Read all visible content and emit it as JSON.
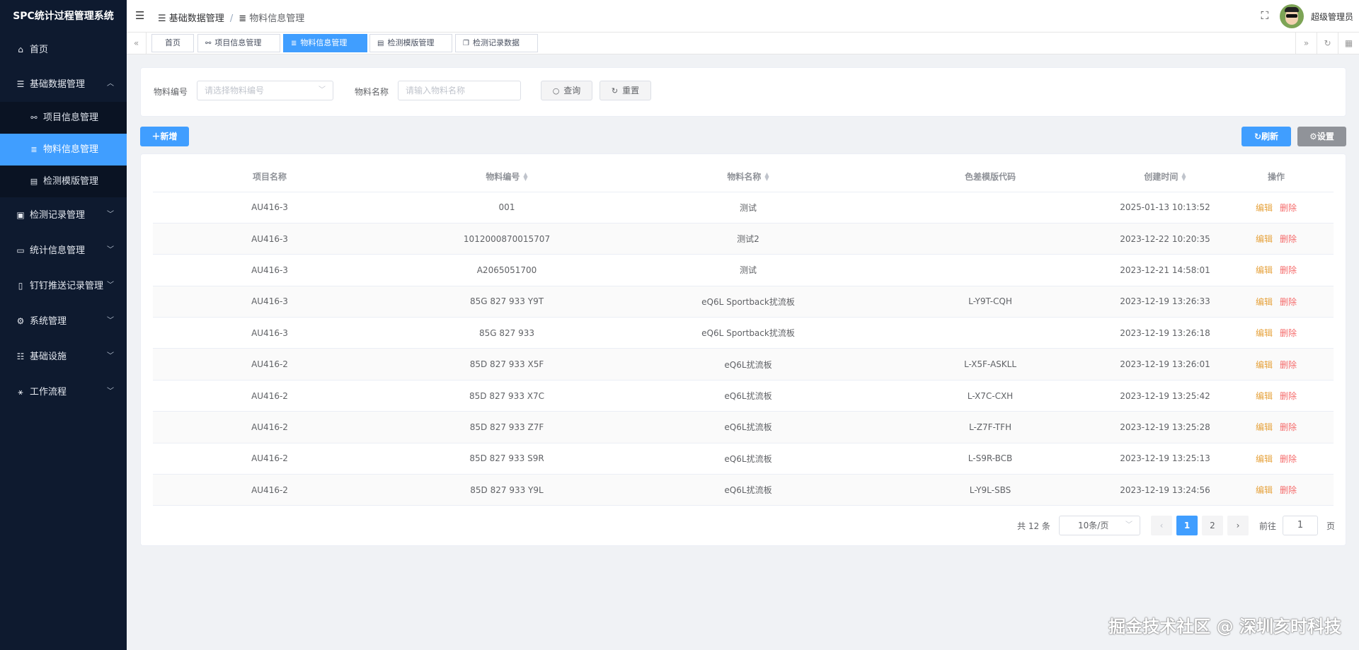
{
  "app": {
    "title": "SPC统计过程管理系统"
  },
  "sidebar": {
    "home": "首页",
    "basic_data": "基础数据管理",
    "sub": [
      "项目信息管理",
      "物料信息管理",
      "检测模版管理"
    ],
    "others": [
      "检测记录管理",
      "统计信息管理",
      "钉钉推送记录管理",
      "系统管理",
      "基础设施",
      "工作流程"
    ]
  },
  "header": {
    "breadcrumb": [
      "基础数据管理",
      "物料信息管理"
    ],
    "username": "超级管理员"
  },
  "tags": [
    "首页",
    "项目信息管理",
    "物料信息管理",
    "检测模版管理",
    "检测记录数据"
  ],
  "search": {
    "code_label": "物料编号",
    "code_placeholder": "请选择物料编号",
    "name_label": "物料名称",
    "name_placeholder": "请输入物料名称",
    "query_label": "查询",
    "reset_label": "重置"
  },
  "toolbar": {
    "add_label": "新增",
    "refresh_label": "刷新",
    "settings_label": "设置"
  },
  "table": {
    "headers": [
      "项目名称",
      "物料编号",
      "物料名称",
      "色差模版代码",
      "创建时间",
      "操作"
    ],
    "edit_label": "编辑",
    "delete_label": "删除",
    "rows": [
      [
        "AU416-3",
        "001",
        "测试",
        "",
        "2025-01-13 10:13:52"
      ],
      [
        "AU416-3",
        "1012000870015707",
        "测试2",
        "",
        "2023-12-22 10:20:35"
      ],
      [
        "AU416-3",
        "A2065051700",
        "测试",
        "",
        "2023-12-21 14:58:01"
      ],
      [
        "AU416-3",
        "85G 827 933 Y9T",
        "eQ6L Sportback扰流板",
        "L-Y9T-CQH",
        "2023-12-19 13:26:33"
      ],
      [
        "AU416-3",
        "85G 827 933",
        "eQ6L Sportback扰流板",
        "",
        "2023-12-19 13:26:18"
      ],
      [
        "AU416-2",
        "85D 827 933 X5F",
        "eQ6L扰流板",
        "L-X5F-ASKLL",
        "2023-12-19 13:26:01"
      ],
      [
        "AU416-2",
        "85D 827 933 X7C",
        "eQ6L扰流板",
        "L-X7C-CXH",
        "2023-12-19 13:25:42"
      ],
      [
        "AU416-2",
        "85D 827 933 Z7F",
        "eQ6L扰流板",
        "L-Z7F-TFH",
        "2023-12-19 13:25:28"
      ],
      [
        "AU416-2",
        "85D 827 933 S9R",
        "eQ6L扰流板",
        "L-S9R-BCB",
        "2023-12-19 13:25:13"
      ],
      [
        "AU416-2",
        "85D 827 933 Y9L",
        "eQ6L扰流板",
        "L-Y9L-SBS",
        "2023-12-19 13:24:56"
      ]
    ]
  },
  "pagination": {
    "total": "共 12 条",
    "page_size": "10条/页",
    "pages": [
      "1",
      "2"
    ],
    "goto_label": "前往",
    "goto_value": "1",
    "page_suffix": "页"
  },
  "watermark": "掘金技术社区 @ 深圳亥时科技"
}
